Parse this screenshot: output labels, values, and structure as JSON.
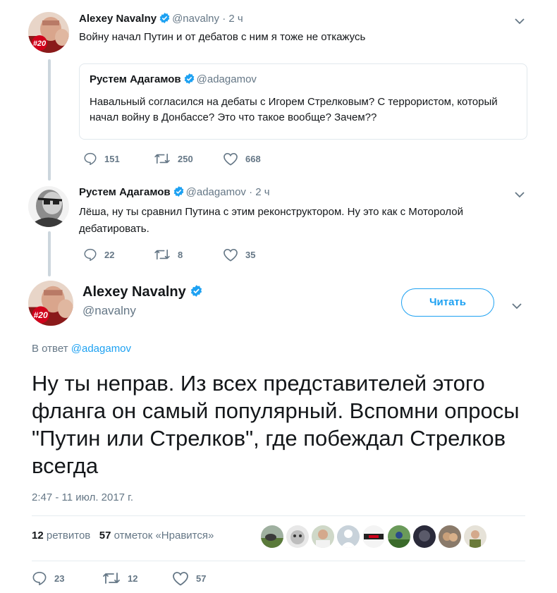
{
  "tweet1": {
    "name": "Alexey Navalny",
    "handle": "@navalny",
    "time": "· 2 ч",
    "text": "Войну начал Путин и от дебатов с ним я тоже не откажусь",
    "avatar_badge": "#20",
    "quote": {
      "name": "Рустем Адагамов",
      "handle": "@adagamov",
      "text": "Навальный согласился на дебаты с Игорем Стрелковым? С террористом, который начал войну в Донбассе? Это что такое вообще? Зачем??"
    },
    "replies": "151",
    "retweets": "250",
    "likes": "668"
  },
  "tweet2": {
    "name": "Рустем Адагамов",
    "handle": "@adagamov",
    "time": "· 2 ч",
    "text": "Лёша, ну ты сравнил Путина с этим реконструктором. Ну это как с Моторолой дебатировать.",
    "replies": "22",
    "retweets": "8",
    "likes": "35"
  },
  "main": {
    "name": "Alexey Navalny",
    "handle": "@navalny",
    "avatar_badge": "#20",
    "follow_label": "Читать",
    "reply_to_prefix": "В ответ",
    "reply_to_handle": "@adagamov",
    "text": "Ну ты неправ. Из всех представителей этого фланга он самый популярный. Вспомни опросы \"Путин или Стрелков\", где побеждал Стрелков всегда",
    "timestamp": "2:47 - 11 июл. 2017 г.",
    "retweets_count": "12",
    "retweets_label": "ретвитов",
    "likes_count": "57",
    "likes_label": "отметок «Нравится»",
    "replies": "23",
    "retweets": "12",
    "likes": "57"
  },
  "icons": {
    "reply": "reply-icon",
    "retweet": "retweet-icon",
    "like": "heart-icon",
    "verified": "verified-badge-icon",
    "more": "chevron-down-icon"
  },
  "colors": {
    "accent": "#1da1f2",
    "muted": "#657786",
    "text": "#14171a",
    "border": "#e1e8ed",
    "badge_red": "#d0021b"
  }
}
